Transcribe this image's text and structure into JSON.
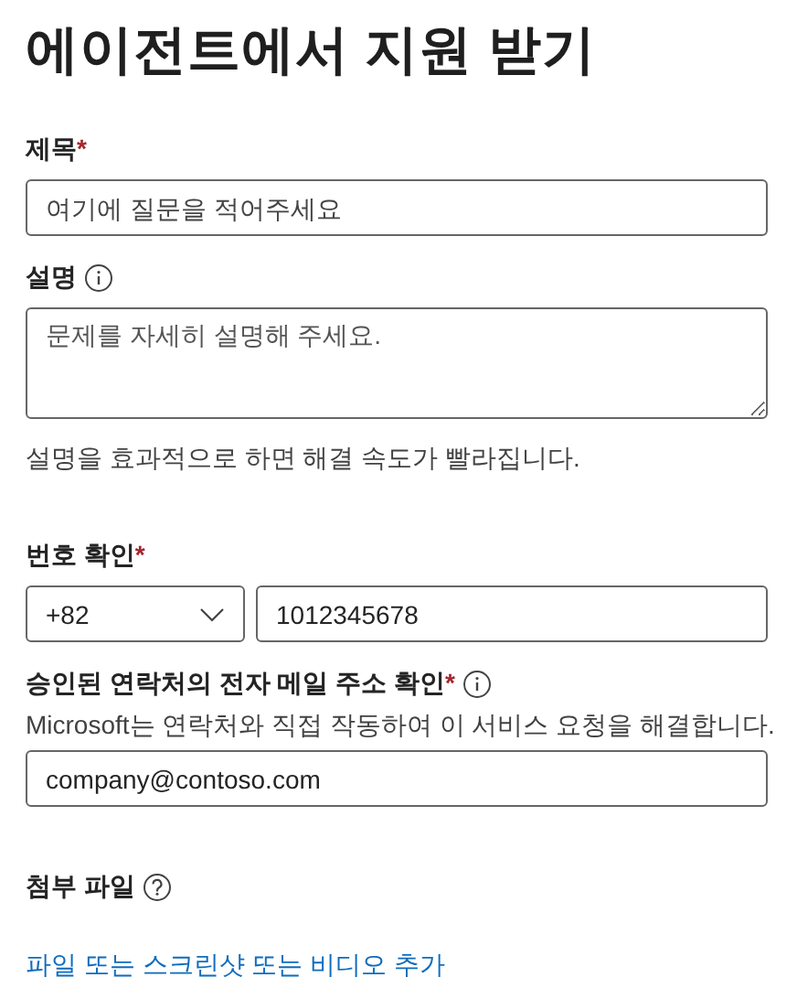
{
  "page": {
    "title": "에이전트에서 지원 받기"
  },
  "fields": [
    {
      "kind": "text",
      "label": "제목",
      "required_mark": "*",
      "placeholder": "여기에 질문을 적어주세요"
    },
    {
      "kind": "textarea",
      "label": "설명",
      "placeholder": "문제를 자세히 설명해 주세요.",
      "help": "설명을 효과적으로 하면 해결 속도가 빨라집니다."
    },
    {
      "kind": "phone",
      "label": "번호 확인",
      "required_mark": "*",
      "country_code": "+82",
      "phone_number": "1012345678"
    },
    {
      "kind": "email",
      "label": "승인된 연락처의 전자 메일 주소 확인",
      "required_mark": "*",
      "description": "Microsoft는 연락처와 직접 작동하여 이 서비스 요청을 해결합니다.",
      "value": "company@contoso.com"
    },
    {
      "kind": "attachment",
      "label": "첨부 파일",
      "link": "파일 또는 스크린샷 또는 비디오 추가"
    }
  ]
}
